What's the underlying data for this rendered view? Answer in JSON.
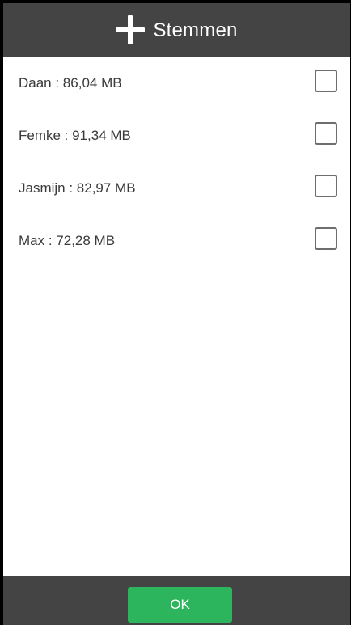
{
  "header": {
    "title": "Stemmen",
    "add_icon": "plus-icon"
  },
  "voices": [
    {
      "label": "Daan : 86,04 MB",
      "checked": false
    },
    {
      "label": "Femke : 91,34 MB",
      "checked": false
    },
    {
      "label": "Jasmijn : 82,97 MB",
      "checked": false
    },
    {
      "label": "Max : 72,28 MB",
      "checked": false
    }
  ],
  "footer": {
    "ok_label": "OK"
  },
  "colors": {
    "header_bg": "#444444",
    "footer_bg": "#444444",
    "ok_button": "#2db55d",
    "checkbox_border": "#6e6e6e",
    "text": "#3a3a3a"
  }
}
